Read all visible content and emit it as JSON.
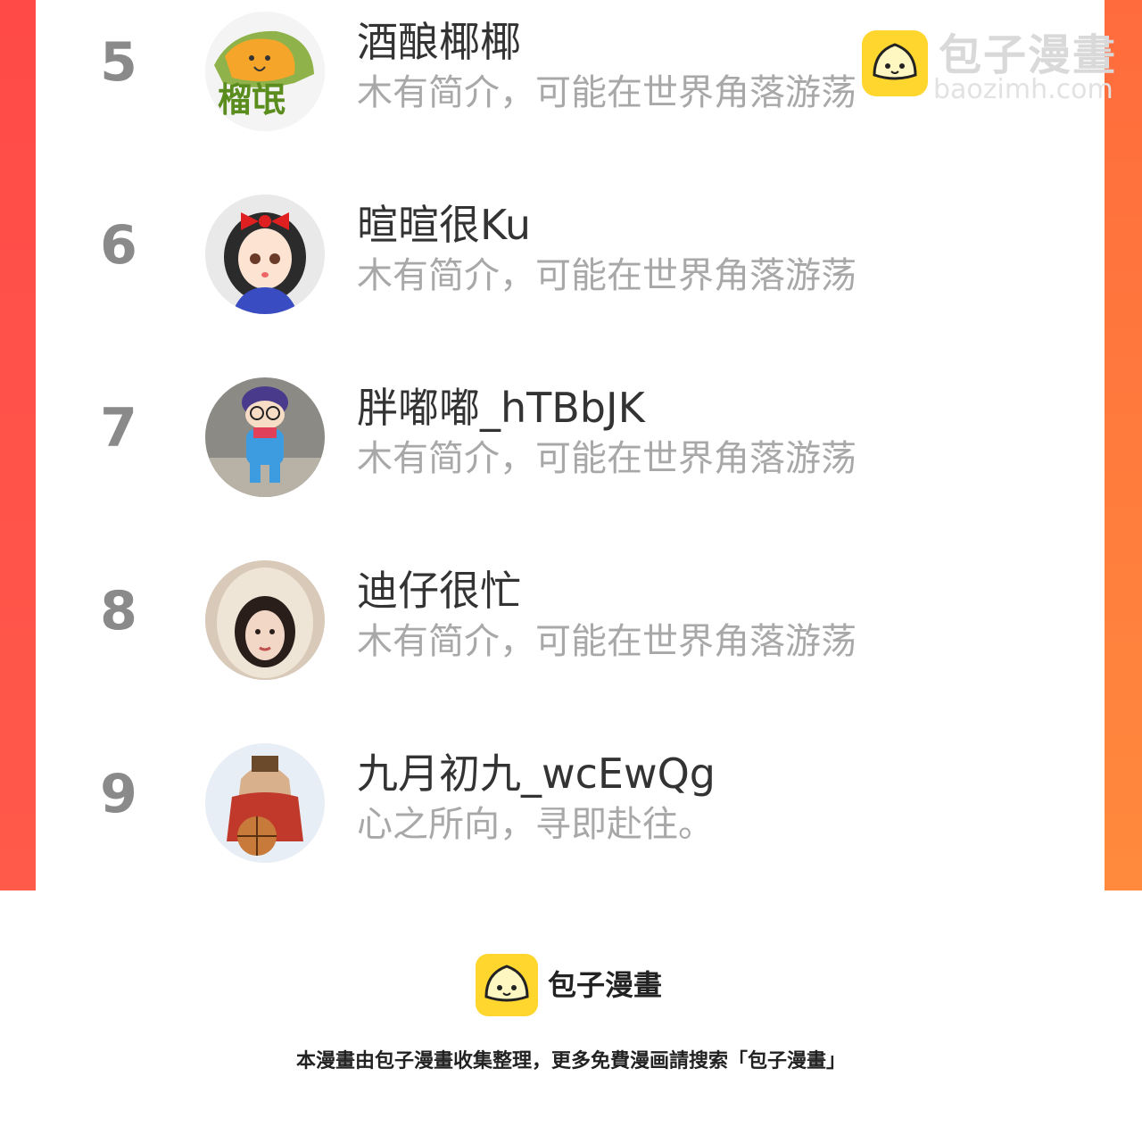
{
  "list": {
    "items": [
      {
        "rank": "5",
        "name": "酒酿椰椰",
        "bio": "木有简介，可能在世界角落游荡",
        "avatar": "durian-avatar",
        "avatar_text": "榴氓"
      },
      {
        "rank": "6",
        "name": "暄暄很Ku",
        "bio": "木有简介，可能在世界角落游荡",
        "avatar": "cartoon-girl-avatar"
      },
      {
        "rank": "7",
        "name": "胖嘟嘟_hTBbJK",
        "bio": "木有简介，可能在世界角落游荡",
        "avatar": "arale-figure-avatar"
      },
      {
        "rank": "8",
        "name": "迪仔很忙",
        "bio": "木有简介，可能在世界角落游荡",
        "avatar": "woman-portrait-avatar"
      },
      {
        "rank": "9",
        "name": "九月初九_wcEwQg",
        "bio": "心之所向，寻即赴往。",
        "avatar": "basketball-anime-avatar"
      }
    ]
  },
  "watermark": {
    "title": "包子漫畫",
    "url": "baozimh.com"
  },
  "footer": {
    "brand": "包子漫畫",
    "note": "本漫畫由包子漫畫收集整理，更多免費漫画請搜索「包子漫畫」"
  },
  "colors": {
    "side_left": "#ff4a48",
    "side_right": "#ff7a3d",
    "logo_yellow": "#ffd62e"
  }
}
